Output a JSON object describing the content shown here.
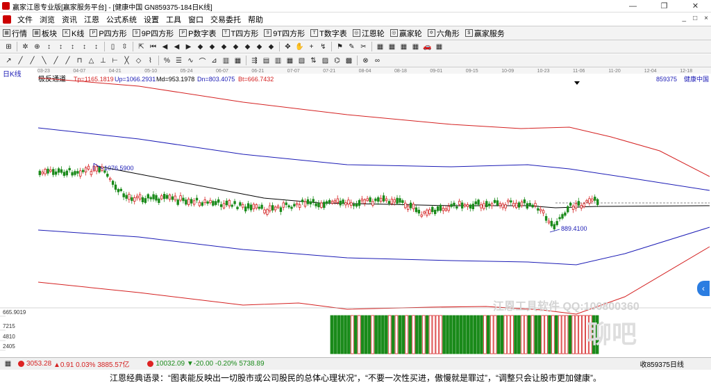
{
  "window": {
    "title": "赢家江恩专业版[赢家服务平台] - [健康中国  GN859375-184日K线]",
    "minimize": "—",
    "maximize": "❐",
    "close": "✕"
  },
  "menu": {
    "items": [
      "文件",
      "浏览",
      "资讯",
      "江恩",
      "公式系统",
      "设置",
      "工具",
      "窗口",
      "交易委托",
      "帮助"
    ],
    "right_controls": [
      "_",
      "□",
      "×"
    ]
  },
  "toolbar1": {
    "items": [
      {
        "icon": "▦",
        "label": "行情"
      },
      {
        "icon": "▦",
        "label": "板块"
      },
      {
        "icon": "K",
        "label": "K线"
      },
      {
        "icon": "P",
        "label": "P四方形"
      },
      {
        "icon": "9",
        "label": "9P四方形"
      },
      {
        "icon": "P",
        "label": "P数字表"
      },
      {
        "icon": "T",
        "label": "T四方形"
      },
      {
        "icon": "9",
        "label": "9T四方形"
      },
      {
        "icon": "T",
        "label": "T数字表"
      },
      {
        "icon": "◎",
        "label": "江恩轮"
      },
      {
        "icon": "◎",
        "label": "赢家轮"
      },
      {
        "icon": "✡",
        "label": "六角形"
      },
      {
        "icon": "$",
        "label": "赢家服务"
      }
    ]
  },
  "toolbar2": {
    "tools": [
      "⊞",
      "✲",
      "⊕",
      "↕",
      "↕",
      "↕",
      "↕",
      "↕",
      "▯",
      "⇳",
      "⇱",
      "⏮",
      "◀",
      "◀",
      "▶",
      "◆",
      "◆",
      "◆",
      "◆",
      "◆",
      "◆",
      "◆",
      "✥",
      "✋",
      "+",
      "↯",
      "⚑",
      "✎",
      "✂",
      "▦",
      "▦",
      "▦",
      "▦",
      "🚗",
      "▦"
    ]
  },
  "toolbar3": {
    "tools": [
      "↗",
      "╱",
      "╱",
      "╲",
      "╱",
      "╱",
      "⊓",
      "△",
      "⊥",
      "⊢",
      "╳",
      "◇",
      "⌇",
      "%",
      "☰",
      "∿",
      "⌒",
      "⊿",
      "▥",
      "▦",
      "⇶",
      "▤",
      "▥",
      "▦",
      "▧",
      "⇅",
      "▨",
      "⌬",
      "▩",
      "⊗",
      "∞"
    ]
  },
  "chart": {
    "period_label": "日K线",
    "indicator_name": "极反通道",
    "tp": "Tp=1165.1819",
    "up": "Up=1066.2931",
    "md": "Md=953.1978",
    "dn": "Dn=803.4075",
    "bt": "Bt=666.7432",
    "stock_code": "859375",
    "stock_name": "健康中国",
    "date_ticks": [
      "03-23",
      "04-07",
      "04-21",
      "05-10",
      "05-24",
      "06-07",
      "06-21",
      "07-07",
      "07-21",
      "08-04",
      "08-18",
      "09-01",
      "09-15",
      "10-09",
      "10-23",
      "11-06",
      "11-20",
      "12-04",
      "12-18"
    ],
    "high_label": "1076.5900",
    "low_label": "889.4100",
    "volume_axis": [
      "665.9019",
      "7215",
      "4810",
      "2405"
    ],
    "colors": {
      "top": "#d42020",
      "upper": "#1a1ab5",
      "mid": "#000000",
      "candle_up": "#d42020",
      "candle_down": "#1a8a1a"
    }
  },
  "watermark": {
    "line1": "江恩工具软件  QQ:100800360",
    "line2": "聊吧"
  },
  "side_button": "‹",
  "status": {
    "market1": "3053.28",
    "market1_change": "▲0.91 0.03% 3885.57亿",
    "market2": "10032.09",
    "market2_change": "▼-20.00 -0.20% 5738.89",
    "right_text": "收859375日线"
  },
  "quote": "江恩经典语录：“图表能反映出一切股市或公司股民的总体心理状况”，“不要一次性买进，傲慢就是罪过”，“调整只会让股市更加健康”。"
}
